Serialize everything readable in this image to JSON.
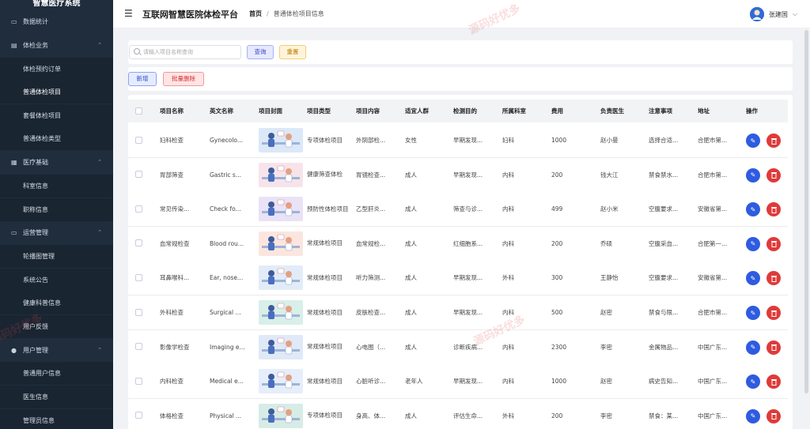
{
  "sidebar": {
    "logo": "智慧医疗系统",
    "items": [
      {
        "label": "数据统计",
        "icon": "monitor-icon",
        "kind": "top"
      },
      {
        "label": "体检业务",
        "icon": "clipboard-icon",
        "kind": "group"
      },
      {
        "label": "体检预约订单",
        "kind": "sub"
      },
      {
        "label": "普通体检项目",
        "kind": "sub",
        "active": true
      },
      {
        "label": "套餐体检项目",
        "kind": "sub"
      },
      {
        "label": "普通体检类型",
        "kind": "sub"
      },
      {
        "label": "医疗基础",
        "icon": "grid-icon",
        "kind": "group"
      },
      {
        "label": "科室信息",
        "kind": "sub"
      },
      {
        "label": "职称信息",
        "kind": "sub"
      },
      {
        "label": "运营管理",
        "icon": "desktop-icon",
        "kind": "group"
      },
      {
        "label": "轮播图管理",
        "kind": "sub"
      },
      {
        "label": "系统公告",
        "kind": "sub"
      },
      {
        "label": "健康科普信息",
        "kind": "sub"
      },
      {
        "label": "用户反馈",
        "kind": "sub"
      },
      {
        "label": "用户管理",
        "icon": "user-icon",
        "kind": "group"
      },
      {
        "label": "普通用户信息",
        "kind": "sub"
      },
      {
        "label": "医生信息",
        "kind": "sub"
      },
      {
        "label": "管理员信息",
        "kind": "sub"
      }
    ]
  },
  "header": {
    "title": "互联网智慧医院体检平台",
    "breadcrumb_home": "首页",
    "breadcrumb_sep": "/",
    "breadcrumb_current": "普通体检项目信息",
    "user_name": "张建国"
  },
  "search": {
    "placeholder": "请输入项目名称查询",
    "query_label": "查询",
    "reset_label": "重置"
  },
  "actions": {
    "add_label": "新增",
    "batch_delete_label": "批量删除"
  },
  "table": {
    "columns": [
      "项目名称",
      "英文名称",
      "项目封面",
      "项目类型",
      "项目内容",
      "适宜人群",
      "检测目的",
      "所属科室",
      "费用",
      "负责医生",
      "注意事项",
      "地址",
      "操作"
    ],
    "rows": [
      {
        "name": "妇科检查",
        "en": "Gynecolo...",
        "cover": "cover-illustration-1",
        "type": "专项体检项目",
        "content": "外阴部检...",
        "crowd": "女性",
        "purpose": "早期发现...",
        "dept": "妇科",
        "fee": "1000",
        "doctor": "赵小曼",
        "notice": "选择合适...",
        "addr": "合肥市第..."
      },
      {
        "name": "胃部筛查",
        "en": "Gastric s...",
        "cover": "cover-illustration-2",
        "type": "健康筛查体检",
        "content": "胃镜检查...",
        "crowd": "成人",
        "purpose": "早期发现...",
        "dept": "内科",
        "fee": "200",
        "doctor": "钱大江",
        "notice": "禁食禁水...",
        "addr": "合肥市第..."
      },
      {
        "name": "常见传染...",
        "en": "Check fo...",
        "cover": "cover-illustration-3",
        "type": "预防性体检项目",
        "content": "乙型肝炎...",
        "crowd": "成人",
        "purpose": "筛查与诊...",
        "dept": "内科",
        "fee": "499",
        "doctor": "赵小米",
        "notice": "空腹要求...",
        "addr": "安徽省第..."
      },
      {
        "name": "血常规检查",
        "en": "Blood rou...",
        "cover": "cover-illustration-4",
        "type": "常规体检项目",
        "content": "血常规检...",
        "crowd": "成人",
        "purpose": "红细胞系...",
        "dept": "内科",
        "fee": "200",
        "doctor": "乔硕",
        "notice": "空腹采血...",
        "addr": "合肥第一..."
      },
      {
        "name": "耳鼻喉科...",
        "en": "Ear, nose...",
        "cover": "cover-illustration-5",
        "type": "常规体检项目",
        "content": "听力筛测...",
        "crowd": "成人",
        "purpose": "早期发现...",
        "dept": "外科",
        "fee": "300",
        "doctor": "王静怡",
        "notice": "空腹要求...",
        "addr": "安徽省第..."
      },
      {
        "name": "外科检查",
        "en": "Surgical ...",
        "cover": "cover-illustration-6",
        "type": "常规体检项目",
        "content": "皮肤检查...",
        "crowd": "成人",
        "purpose": "早期发现...",
        "dept": "内科",
        "fee": "500",
        "doctor": "赵密",
        "notice": "禁食与限...",
        "addr": "合肥市第..."
      },
      {
        "name": "影像学检查",
        "en": "Imaging e...",
        "cover": "cover-illustration-7",
        "type": "常规体检项目",
        "content": "心电图（...",
        "crowd": "成人",
        "purpose": "诊断疾病...",
        "dept": "内科",
        "fee": "2300",
        "doctor": "李密",
        "notice": "金属物品...",
        "addr": "中国广东..."
      },
      {
        "name": "内科检查",
        "en": "Medical e...",
        "cover": "cover-illustration-8",
        "type": "常规体检项目",
        "content": "心脏听诊...",
        "crowd": "老年人",
        "purpose": "早期发现...",
        "dept": "内科",
        "fee": "1000",
        "doctor": "赵密",
        "notice": "病史告知...",
        "addr": "中国广东..."
      },
      {
        "name": "体格检查",
        "en": "Physical ...",
        "cover": "cover-illustration-9",
        "type": "专项体检项目",
        "content": "身高、体...",
        "crowd": "成人",
        "purpose": "评估生命...",
        "dept": "外科",
        "fee": "200",
        "doctor": "李密",
        "notice": "禁食：某...",
        "addr": "中国广东..."
      }
    ]
  },
  "watermark_text": "源码好优多",
  "colors": {
    "sidebar_bg": "#1f2d3d",
    "primary": "#2f5be0",
    "danger": "#e03a3a"
  }
}
